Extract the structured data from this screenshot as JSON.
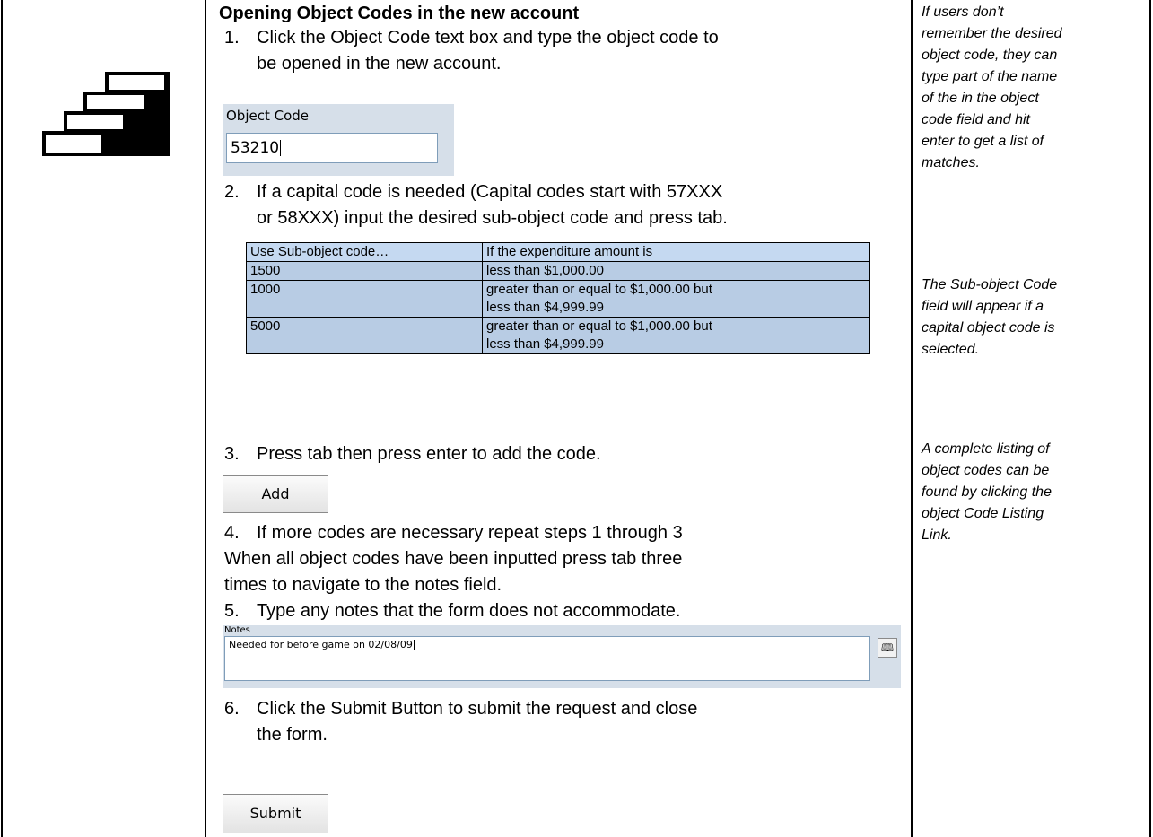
{
  "section": {
    "title": "Opening Object Codes in the new account"
  },
  "steps": [
    {
      "num": "1.",
      "line1": "Click the Object Code text box and type the object code to",
      "line2": "be opened in the new account."
    },
    {
      "num": "2.",
      "line1": "If a capital code is needed (Capital codes start with 57XXX",
      "line2": "or 58XXX) input the desired sub-object code and press tab."
    },
    {
      "num": "3.",
      "line1": "Press tab then press enter to add the code."
    },
    {
      "num": "4.",
      "line1": "If more codes are necessary repeat steps 1 through 3"
    },
    {
      "num": "5.",
      "line1": "Type any notes that the form does not accommodate."
    },
    {
      "num": "6.",
      "line1": "Click the Submit Button to submit the request and close",
      "line2": "the form."
    }
  ],
  "after_step4": {
    "line1": "When all object codes have been inputted press tab three",
    "line2": "times to navigate to the notes field."
  },
  "object_code_widget": {
    "label": "Object Code",
    "value": "53210"
  },
  "sub_object_table": {
    "headers": [
      "Use Sub-object code…",
      "If the expenditure amount is"
    ],
    "rows": [
      [
        "1500",
        "less than $1,000.00",
        ""
      ],
      [
        "1000",
        "greater than or equal to $1,000.00 but",
        "less than $4,999.99"
      ],
      [
        "5000",
        "greater than or equal to $1,000.00 but",
        "less than $4,999.99"
      ]
    ],
    "header_color": "#c5d9f1",
    "cell_color": "#b8cce4"
  },
  "add_button": {
    "label": "Add"
  },
  "notes_widget": {
    "label": "Notes",
    "value": "Needed for before game on 02/08/09",
    "book_icon": "book-icon"
  },
  "submit_button": {
    "label": "Submit"
  },
  "side_notes": [
    [
      "If users don’t",
      "remember the desired",
      "object code, they can",
      "type part of the name",
      "of the in the object",
      "code field and hit",
      "enter to get a list of",
      "matches."
    ],
    [
      "The Sub-object Code",
      "field will appear if a",
      "capital object code is",
      "selected."
    ],
    [
      "A complete listing of",
      "object codes can be",
      "found by clicking the",
      "object Code Listing",
      "Link."
    ]
  ],
  "icon": "stairs-icon"
}
